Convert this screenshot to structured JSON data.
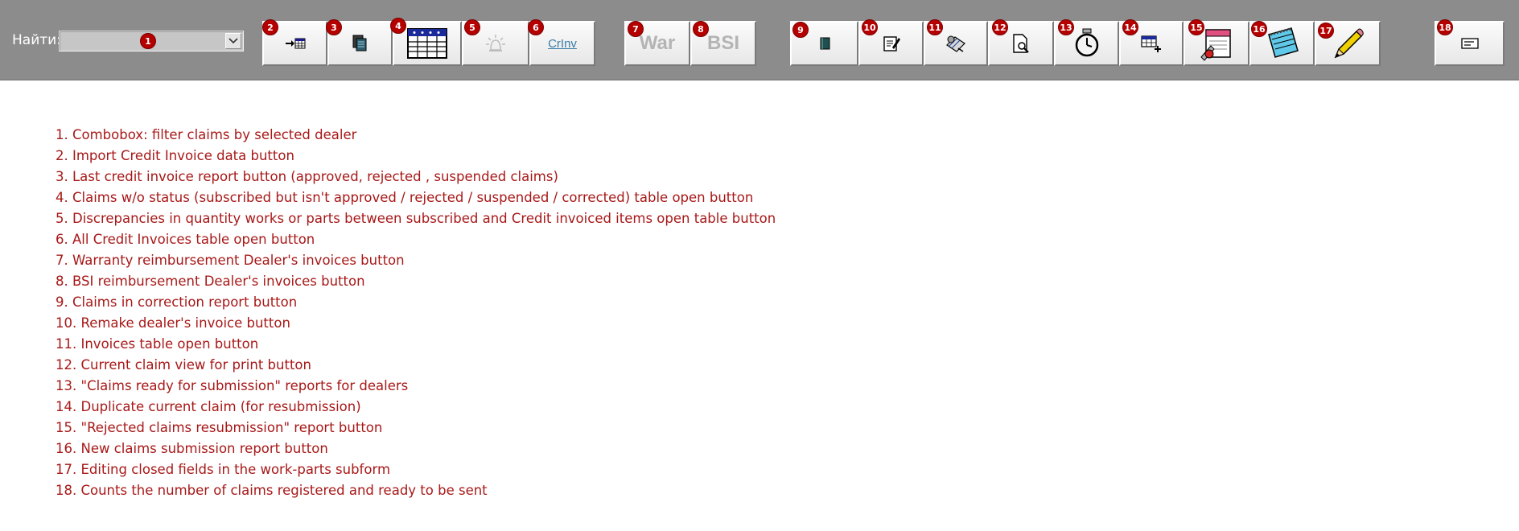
{
  "toolbar": {
    "find_label": "Найти:",
    "combo": {
      "value": ""
    },
    "buttons": [
      {
        "num": "2"
      },
      {
        "num": "3"
      },
      {
        "num": "4"
      },
      {
        "num": "5"
      },
      {
        "num": "6",
        "text": "CrInv"
      },
      {
        "num": "7",
        "text": "War"
      },
      {
        "num": "8",
        "text": "BSI"
      },
      {
        "num": "9"
      },
      {
        "num": "10"
      },
      {
        "num": "11"
      },
      {
        "num": "12"
      },
      {
        "num": "13"
      },
      {
        "num": "14"
      },
      {
        "num": "15"
      },
      {
        "num": "16"
      },
      {
        "num": "17"
      },
      {
        "num": "18"
      }
    ],
    "combo_badge": "1"
  },
  "legend": [
    "1. Combobox: filter claims by selected dealer",
    "2. Import Credit Invoice data button",
    "3. Last credit invoice report button (approved, rejected , suspended claims)",
    "4. Claims w/o status (subscribed but isn't approved / rejected / suspended / corrected) table open button",
    "5. Discrepancies in quantity works or parts between subscribed and Credit invoiced items open table button",
    "6. All Credit Invoices table open button",
    "7. Warranty reimbursement Dealer's invoices button",
    "8. BSI reimbursement Dealer's invoices button",
    "9. Claims in correction report button",
    "10. Remake dealer's invoice button",
    "11. Invoices table open button",
    "12. Current claim view for print button",
    "13. \"Claims ready for submission\" reports for dealers",
    "14. Duplicate current claim (for resubmission)",
    "15. \"Rejected claims resubmission\" report button",
    "16. New claims submission report button",
    "17. Editing closed fields in the work-parts subform",
    "18. Counts the number of claims registered and ready to be sent"
  ],
  "colors": {
    "toolbar_bg": "#8c8c8c",
    "badge": "#b50000",
    "legend_text": "#a81818"
  }
}
